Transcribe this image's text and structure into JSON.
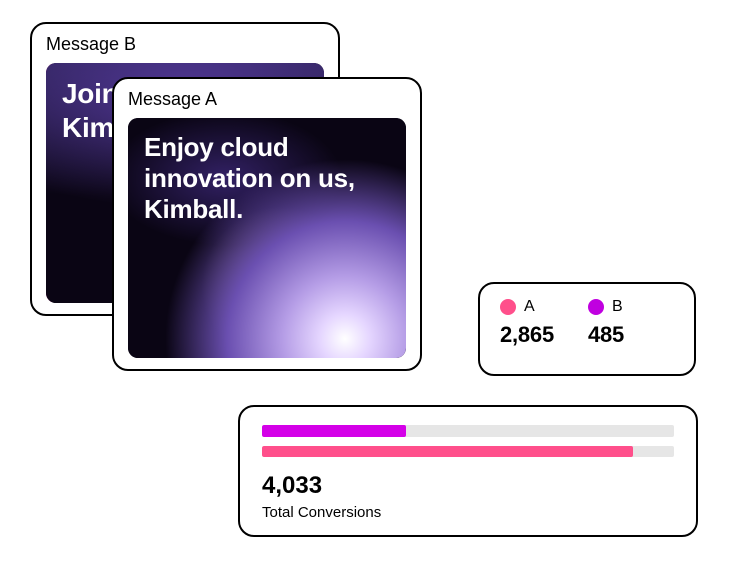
{
  "message_b": {
    "title": "Message B",
    "hero_text": "Join the cloud, Kimball."
  },
  "message_a": {
    "title": "Message A",
    "hero_text": "Enjoy cloud innovation on us, Kimball."
  },
  "legend": {
    "a": {
      "label": "A",
      "value": "2,865",
      "color": "#ff4f8b"
    },
    "b": {
      "label": "B",
      "value": "485",
      "color": "#c000e0"
    }
  },
  "conversions": {
    "total_value": "4,033",
    "total_label": "Total Conversions",
    "bars": {
      "purple_pct": 35,
      "pink_pct": 90
    }
  },
  "chart_data": {
    "type": "bar",
    "title": "Total Conversions",
    "categories": [
      "A",
      "B"
    ],
    "series": [
      {
        "name": "Conversions",
        "values": [
          2865,
          485
        ]
      }
    ],
    "total": 4033,
    "colors": {
      "A": "#ff4f8b",
      "B": "#c000e0"
    },
    "bar_visual_pct": {
      "purple": 35,
      "pink": 90
    }
  }
}
